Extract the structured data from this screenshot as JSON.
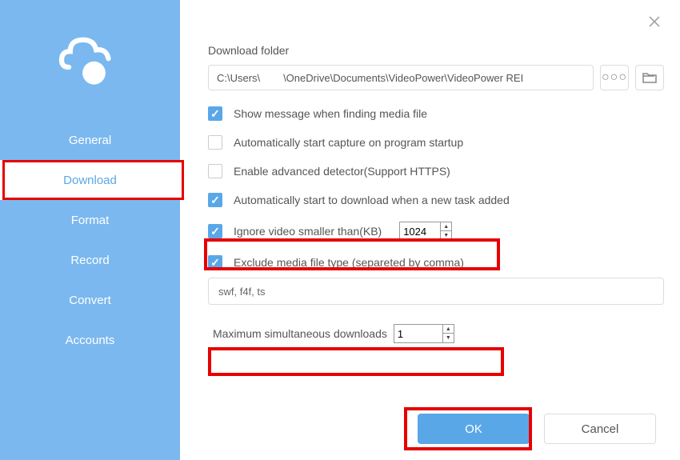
{
  "sidebar": {
    "items": [
      {
        "label": "General"
      },
      {
        "label": "Download"
      },
      {
        "label": "Format"
      },
      {
        "label": "Record"
      },
      {
        "label": "Convert"
      },
      {
        "label": "Accounts"
      }
    ],
    "activeIndex": 1
  },
  "content": {
    "folderLabel": "Download folder",
    "folderPath": "C:\\Users\\        \\OneDrive\\Documents\\VideoPower\\VideoPower REI",
    "check1": "Show message when finding media file",
    "check2": "Automatically start capture on program startup",
    "check3": "Enable advanced detector(Support HTTPS)",
    "check4": "Automatically start to download when a new task added",
    "check5": "Ignore video smaller than(KB)",
    "check5Value": "1024",
    "check6": "Exclude media file type (separeted by comma)",
    "excludeValue": "swf, f4f, ts",
    "maxLabel": "Maximum simultaneous downloads",
    "maxValue": "1"
  },
  "buttons": {
    "ok": "OK",
    "cancel": "Cancel"
  }
}
